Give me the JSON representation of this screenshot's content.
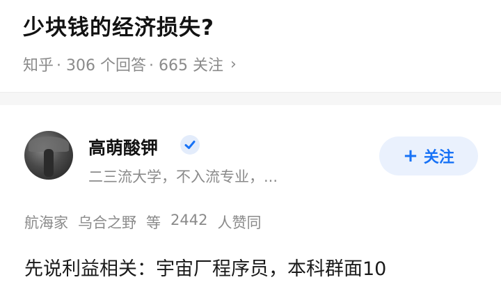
{
  "question": {
    "title": "少块钱的经济损失?",
    "source": "知乎",
    "answer_count": "· 306 个回答",
    "follower_count": "· 665 关注"
  },
  "answer": {
    "author_name": "高萌酸钾",
    "author_bio": "二三流大学，不入流专业，...",
    "follow_label": "关注",
    "endorsers": [
      "航海家",
      "乌合之野",
      "等"
    ],
    "endorse_count": "2442",
    "endorse_suffix": "人赞同",
    "body_excerpt": "先说利益相关：宇宙厂程序员，本科群面10"
  },
  "colors": {
    "accent": "#1772f6",
    "follow_bg": "#eaf1fd",
    "meta_text": "#8a8a8a"
  },
  "icons": [
    "chevron-right-icon",
    "verified-badge-icon",
    "plus-icon",
    "avatar"
  ]
}
